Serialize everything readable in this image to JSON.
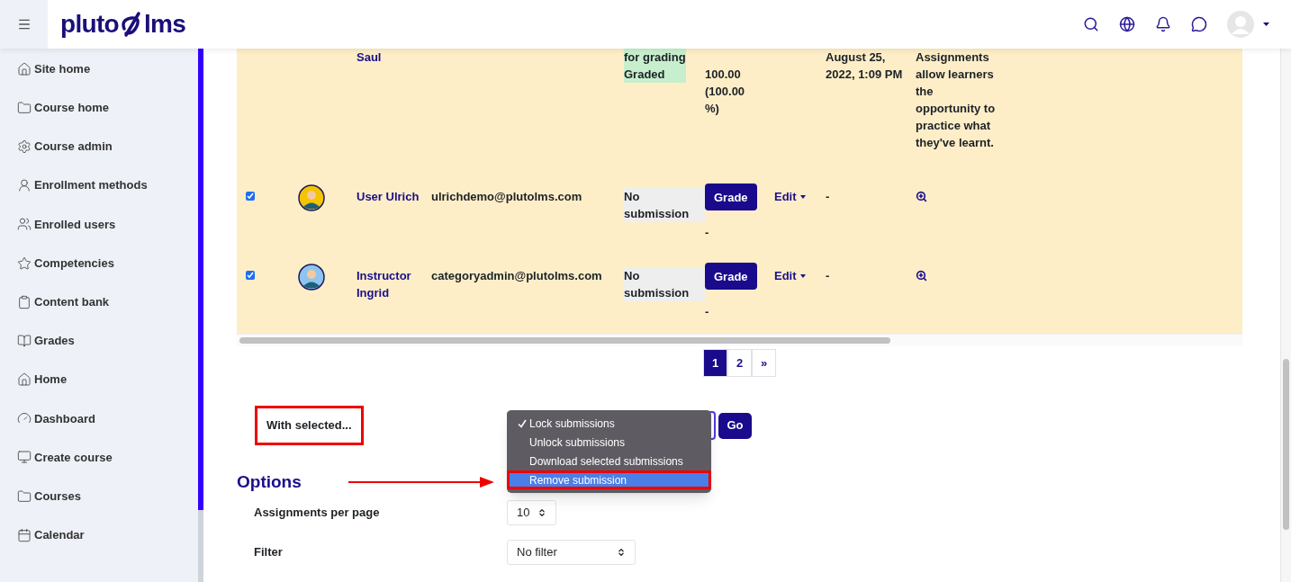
{
  "header": {
    "logo": {
      "left": "pluto",
      "right": "lms"
    }
  },
  "sidebar": {
    "items": [
      {
        "label": "Site home"
      },
      {
        "label": "Course home"
      },
      {
        "label": "Course admin"
      },
      {
        "label": "Enrollment methods"
      },
      {
        "label": "Enrolled users"
      },
      {
        "label": "Competencies"
      },
      {
        "label": "Content bank"
      },
      {
        "label": "Grades"
      },
      {
        "label": "Home"
      },
      {
        "label": "Dashboard"
      },
      {
        "label": "Create course"
      },
      {
        "label": "Courses"
      },
      {
        "label": "Calendar"
      }
    ]
  },
  "table": {
    "rows": [
      {
        "name": "Saul",
        "status": [
          "for grading",
          "Graded"
        ],
        "graded": true,
        "grade": "100.00 (100.00 %)",
        "last_modified": "August 25, 2022, 1:09 PM",
        "feedback": "Assignments allow learners the opportunity to practice what they've learnt."
      },
      {
        "checked": true,
        "avatar": true,
        "name": "User Ulrich",
        "email": "ulrichdemo@plutolms.com",
        "status": [
          "No submission"
        ],
        "graded": false,
        "grade_button": "Grade",
        "grade": "-",
        "edit": "Edit",
        "last_modified": "-"
      },
      {
        "checked": true,
        "avatar": true,
        "name": "Instructor Ingrid",
        "email": "categoryadmin@plutolms.com",
        "status": [
          "No submission"
        ],
        "graded": false,
        "grade_button": "Grade",
        "grade": "-",
        "edit": "Edit",
        "last_modified": "-"
      }
    ]
  },
  "pagination": [
    {
      "label": "1",
      "selected": true
    },
    {
      "label": "2",
      "selected": false
    },
    {
      "label": "»",
      "selected": false
    }
  ],
  "with_selected": {
    "label": "With selected...",
    "outlined": true,
    "options": [
      {
        "label": "Lock submissions",
        "selected": true,
        "highlighted": false,
        "outlined": false
      },
      {
        "label": "Unlock submissions",
        "selected": false,
        "highlighted": false,
        "outlined": false
      },
      {
        "label": "Download selected submissions",
        "selected": false,
        "highlighted": false,
        "outlined": false
      },
      {
        "label": "Remove submission",
        "selected": false,
        "highlighted": true,
        "outlined": true
      }
    ],
    "go_button": "Go"
  },
  "options": {
    "title": "Options",
    "fields": [
      {
        "label": "Assignments per page",
        "value": "10"
      },
      {
        "label": "Filter",
        "value": "No filter"
      }
    ]
  }
}
